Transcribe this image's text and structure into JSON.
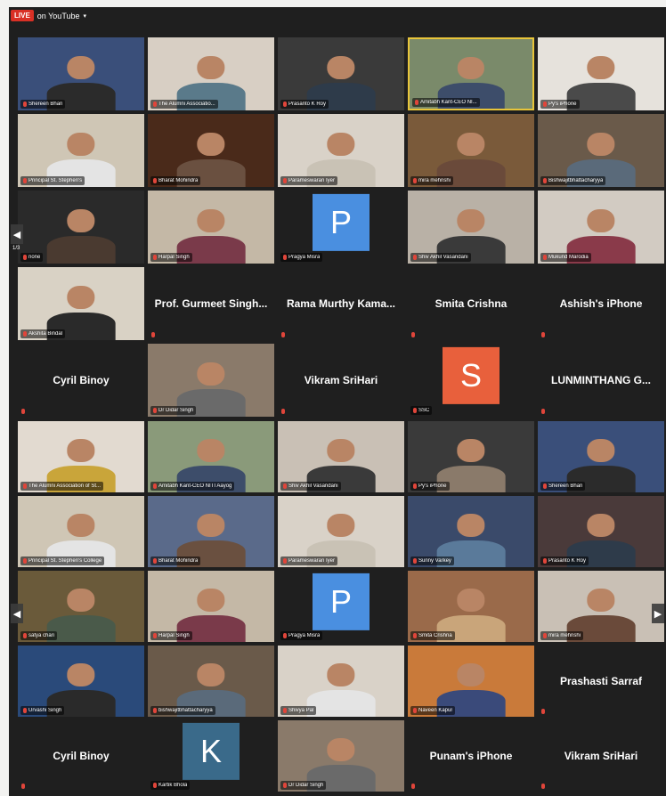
{
  "topbar": {
    "live_badge": "LIVE",
    "live_label": "on YouTube",
    "caret": "▾"
  },
  "pager": {
    "left_arrow": "◀",
    "right_arrow": "▶",
    "page_label": "1/3"
  },
  "grid1": [
    {
      "kind": "video",
      "name": "Shereen Bhan",
      "wall": "#3a4f7a",
      "shirt": "#2b2b2b"
    },
    {
      "kind": "video",
      "name": "The Alumni Associatio...",
      "wall": "#d8cfc4",
      "shirt": "#5a7a8a"
    },
    {
      "kind": "video",
      "name": "Prasanto K Roy",
      "wall": "#3a3a3a",
      "shirt": "#2e3b4a"
    },
    {
      "kind": "video",
      "name": "Amitabh Kant-CEO NI...",
      "wall": "#7a8a6a",
      "shirt": "#3d4d6a",
      "active": true
    },
    {
      "kind": "video",
      "name": "Py's iPhone",
      "wall": "#e6e2dc",
      "shirt": "#4a4a4a"
    },
    {
      "kind": "video",
      "name": "Principal St. Stephen's",
      "wall": "#cfc6b5",
      "shirt": "#e4e4e4"
    },
    {
      "kind": "video",
      "name": "Bharat Mohindra",
      "wall": "#4a2a1a",
      "shirt": "#6a5040"
    },
    {
      "kind": "video",
      "name": "Parameswaran Iyer",
      "wall": "#d9d2c8",
      "shirt": "#c9c2b5"
    },
    {
      "kind": "video",
      "name": "mira mehrishi",
      "wall": "#7a5a3a",
      "shirt": "#6a4a3a"
    },
    {
      "kind": "video",
      "name": "Bishwajitbhattacharyya",
      "wall": "#6a5a4a",
      "shirt": "#5a6a7a"
    },
    {
      "kind": "video",
      "name": "none",
      "wall": "#2a2a2a",
      "shirt": "#4a3a30"
    },
    {
      "kind": "video",
      "name": "Harpal Singh",
      "wall": "#c4b8a6",
      "shirt": "#7a3a4a"
    },
    {
      "kind": "avatar",
      "name": "Pragya Misra",
      "letter": "P",
      "color": "#4a8fe0"
    },
    {
      "kind": "video",
      "name": "Shiv Akhil Vasandani",
      "wall": "#b9b1a6",
      "shirt": "#3a3a3a"
    },
    {
      "kind": "video",
      "name": "Mukund Marodia",
      "wall": "#d2cbc2",
      "shirt": "#8a3a4a"
    },
    {
      "kind": "video",
      "name": "Akshita Bindal",
      "wall": "#d9d2c5",
      "shirt": "#2a2a2a"
    },
    {
      "kind": "text",
      "name": "Prof. Gurmeet Singh..."
    },
    {
      "kind": "text",
      "name": "Rama Murthy Kama..."
    },
    {
      "kind": "text",
      "name": "Smita Crishna"
    },
    {
      "kind": "text",
      "name": "Ashish's iPhone"
    },
    {
      "kind": "text",
      "name": "Cyril Binoy"
    },
    {
      "kind": "video",
      "name": "Dr Didar Singh",
      "wall": "#8a7a6a",
      "shirt": "#6a6a6a"
    },
    {
      "kind": "text",
      "name": "Vikram SriHari"
    },
    {
      "kind": "avatar",
      "name": "SSC",
      "letter": "S",
      "color": "#e8603c"
    },
    {
      "kind": "text",
      "name": "LUNMINTHANG G..."
    }
  ],
  "grid2": [
    {
      "kind": "video",
      "name": "The Alumni Association of St...",
      "wall": "#e2dad0",
      "shirt": "#c9a53a"
    },
    {
      "kind": "video",
      "name": "Amitabh Kant-CEO NITI Aayog",
      "wall": "#8a9a7a",
      "shirt": "#3d4d6a"
    },
    {
      "kind": "video",
      "name": "Shiv Akhil Vasandani",
      "wall": "#c9c0b5",
      "shirt": "#3a3a3a"
    },
    {
      "kind": "video",
      "name": "Py's iPhone",
      "wall": "#3a3a3a",
      "shirt": "#8a7a6a"
    },
    {
      "kind": "video",
      "name": "Shereen Bhan",
      "wall": "#3a4f7a",
      "shirt": "#2b2b2b"
    },
    {
      "kind": "video",
      "name": "Principal St. Stephen's College",
      "wall": "#cfc6b5",
      "shirt": "#e4e4e4"
    },
    {
      "kind": "video",
      "name": "Bharat Mohindra",
      "wall": "#5a6a8a",
      "shirt": "#6a5040"
    },
    {
      "kind": "video",
      "name": "Parameswaran Iyer",
      "wall": "#d9d2c8",
      "shirt": "#c9c2b5"
    },
    {
      "kind": "video",
      "name": "Sunny Varkey",
      "wall": "#3a4a6a",
      "shirt": "#5a7a9a"
    },
    {
      "kind": "video",
      "name": "Prasanto K Roy",
      "wall": "#4a3a3a",
      "shirt": "#2e3b4a"
    },
    {
      "kind": "video",
      "name": "satya chari",
      "wall": "#6a5a3a",
      "shirt": "#4a5a4a"
    },
    {
      "kind": "video",
      "name": "Harpal Singh",
      "wall": "#c4b8a6",
      "shirt": "#7a3a4a"
    },
    {
      "kind": "avatar",
      "name": "Pragya Misra",
      "letter": "P",
      "color": "#4a8fe0"
    },
    {
      "kind": "video",
      "name": "Smita Crishna",
      "wall": "#9a6a4a",
      "shirt": "#c9a57a"
    },
    {
      "kind": "video",
      "name": "mira mehrishi",
      "wall": "#c9c0b5",
      "shirt": "#6a4a3a"
    },
    {
      "kind": "video",
      "name": "Urvashi Singh",
      "wall": "#2a4a7a",
      "shirt": "#2a2a2a"
    },
    {
      "kind": "video",
      "name": "bishwajitbhattacharyya",
      "wall": "#6a5a4a",
      "shirt": "#5a6a7a"
    },
    {
      "kind": "video",
      "name": "Shivya Pal",
      "wall": "#d9d2c8",
      "shirt": "#e4e4e4"
    },
    {
      "kind": "video",
      "name": "Naveen Kapur",
      "wall": "#c97a3a",
      "shirt": "#3a4a7a"
    },
    {
      "kind": "text",
      "name": "Prashasti Sarraf"
    },
    {
      "kind": "text",
      "name": "Cyril Binoy"
    },
    {
      "kind": "avatar",
      "name": "Kartik Bhola",
      "letter": "K",
      "color": "#3a6a8a"
    },
    {
      "kind": "video",
      "name": "Dr Didar Singh",
      "wall": "#8a7a6a",
      "shirt": "#6a6a6a"
    },
    {
      "kind": "text",
      "name": "Punam's iPhone"
    },
    {
      "kind": "text",
      "name": "Vikram SriHari"
    }
  ]
}
